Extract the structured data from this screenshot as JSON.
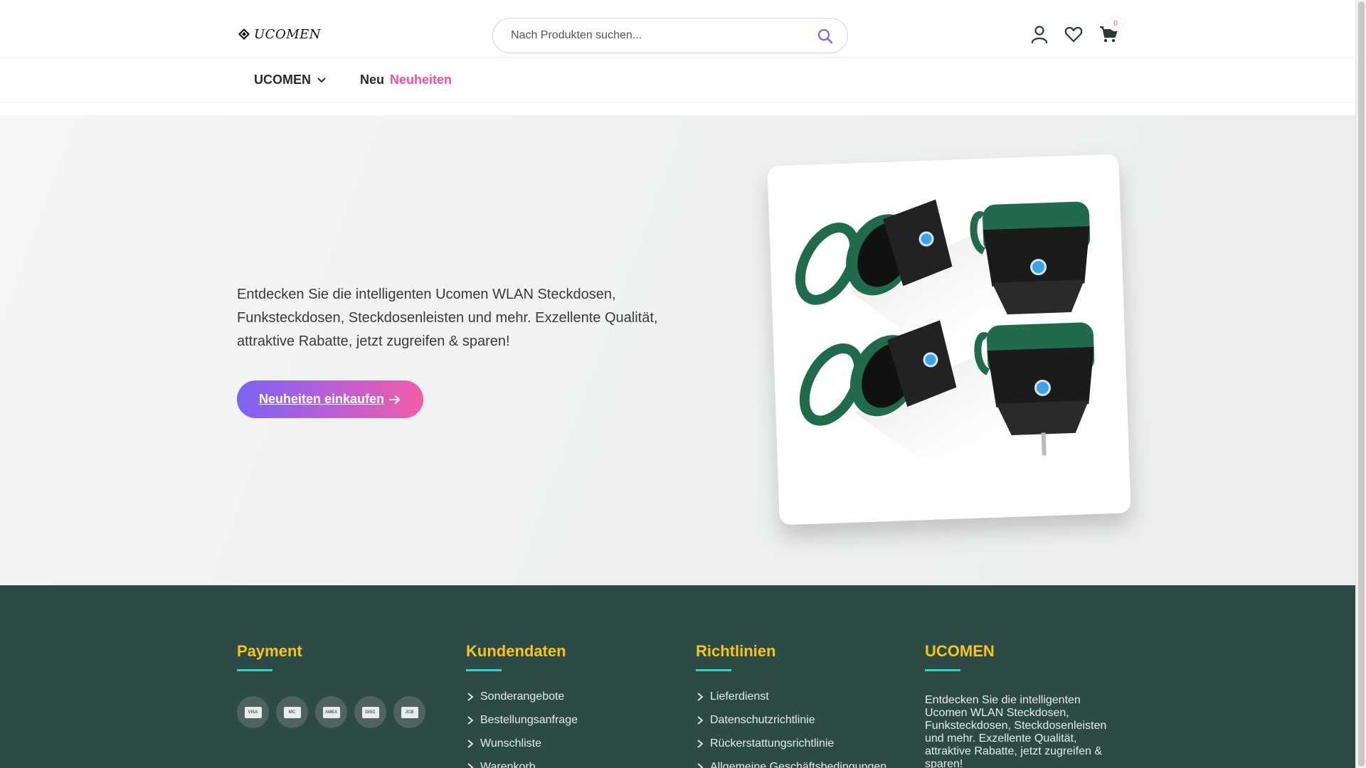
{
  "header": {
    "logo_text": "UCOMEN",
    "search_placeholder": "Nach Produkten suchen...",
    "cart_count": "0",
    "icons": [
      "user-icon",
      "heart-icon",
      "cart-icon",
      "search-icon"
    ]
  },
  "nav": {
    "items": [
      {
        "label": "UCOMEN",
        "has_dropdown": true
      },
      {
        "label_prefix": "Neu",
        "label_highlight": "Neuheiten"
      }
    ]
  },
  "hero": {
    "description": "Entdecken Sie die intelligenten Ucomen WLAN Steckdosen, Funksteckdosen, Steckdosenleisten und mehr. Exzellente Qualität, attraktive Rabatte, jetzt zugreifen & sparen!",
    "cta_label": "Neuheiten einkaufen",
    "cta_icon": "arrow-right-icon"
  },
  "footer": {
    "payment": {
      "title": "Payment",
      "methods": [
        "VISA",
        "MC",
        "AMEX",
        "DISC",
        "JCB"
      ]
    },
    "kundendaten": {
      "title": "Kundendaten",
      "links": [
        "Sonderangebote",
        "Bestellungsanfrage",
        "Wunschliste",
        "Warenkorb"
      ]
    },
    "richtlinien": {
      "title": "Richtlinien",
      "links": [
        "Lieferdienst",
        "Datenschutzrichtlinie",
        "Rückerstattungsrichtlinie",
        "Allgemeine Geschäftsbedingungen"
      ]
    },
    "ucomen": {
      "title": "UCOMEN",
      "text": "Entdecken Sie die intelligenten Ucomen WLAN Steckdosen, Funksteckdosen, Steckdosenleisten und mehr. Exzellente Qualität, attraktive Rabatte, jetzt zugreifen & sparen!"
    }
  },
  "colors": {
    "accent_pink": "#f04ea3",
    "button_gradient_start": "#7b63f3",
    "button_gradient_end": "#f15da7",
    "footer_bg": "#2d4a46",
    "footer_heading": "#f5c518",
    "footer_underline": "#2fd6c0"
  }
}
